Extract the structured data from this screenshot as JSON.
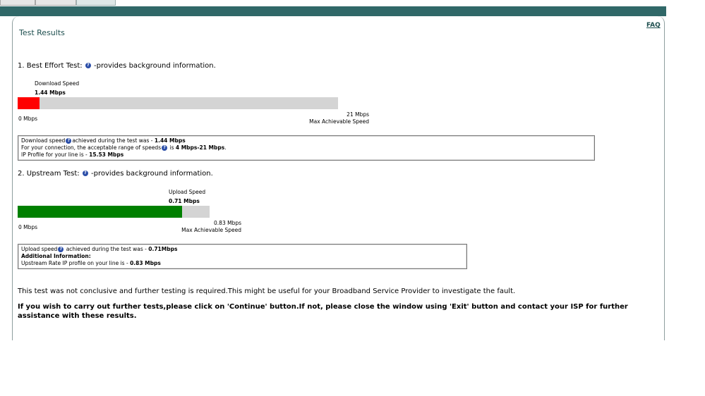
{
  "page": {
    "title": "Test Results",
    "faq_label": "FAQ"
  },
  "best_effort": {
    "heading_prefix": "1. Best Effort Test:",
    "heading_suffix": "-provides background information.",
    "header_label": "Download  Speed",
    "current_value": "1.44 Mbps",
    "min_label": "0 Mbps",
    "max_value": "21 Mbps",
    "max_label": "Max Achievable Speed",
    "fill_fraction": 0.0686,
    "fill_color": "#ff0000",
    "info": {
      "line1_prefix": "Download speed",
      "line1_mid": "achieved during the test was - ",
      "line1_value": "1.44 Mbps",
      "line2_prefix": "For your connection, the acceptable range of speeds",
      "line2_mid": " is ",
      "line2_value": "4 Mbps-21 Mbps",
      "line2_end": ".",
      "line3_prefix": "IP Profile for your line is - ",
      "line3_value": "15.53 Mbps"
    }
  },
  "upstream": {
    "heading_prefix": "2. Upstream Test:",
    "heading_suffix": "-provides background information.",
    "header_label": "Upload Speed",
    "current_value": "0.71 Mbps",
    "min_label": "0 Mbps",
    "max_value": "0.83 Mbps",
    "max_label": "Max Achievable Speed",
    "fill_fraction": 0.855,
    "fill_color": "#008000",
    "info": {
      "line1_prefix": "Upload speed",
      "line1_mid": " achieved during the test was - ",
      "line1_value": "0.71Mbps",
      "line2": "Additional Information:",
      "line3_prefix": "Upstream Rate IP profile on your line is - ",
      "line3_value": "0.83 Mbps"
    }
  },
  "footer": {
    "message": "This test was not conclusive and further testing is required.This might be useful for your Broadband Service Provider to investigate the fault.",
    "instruction": "If you wish to carry out further tests,please click on 'Continue' button.If not, please close the window using 'Exit' button and contact your ISP for further assistance with these results."
  },
  "colors": {
    "topbar": "#306868",
    "title": "#1e4f4f",
    "track": "#d4d4d4",
    "help_icon": "#2b4ea8"
  }
}
